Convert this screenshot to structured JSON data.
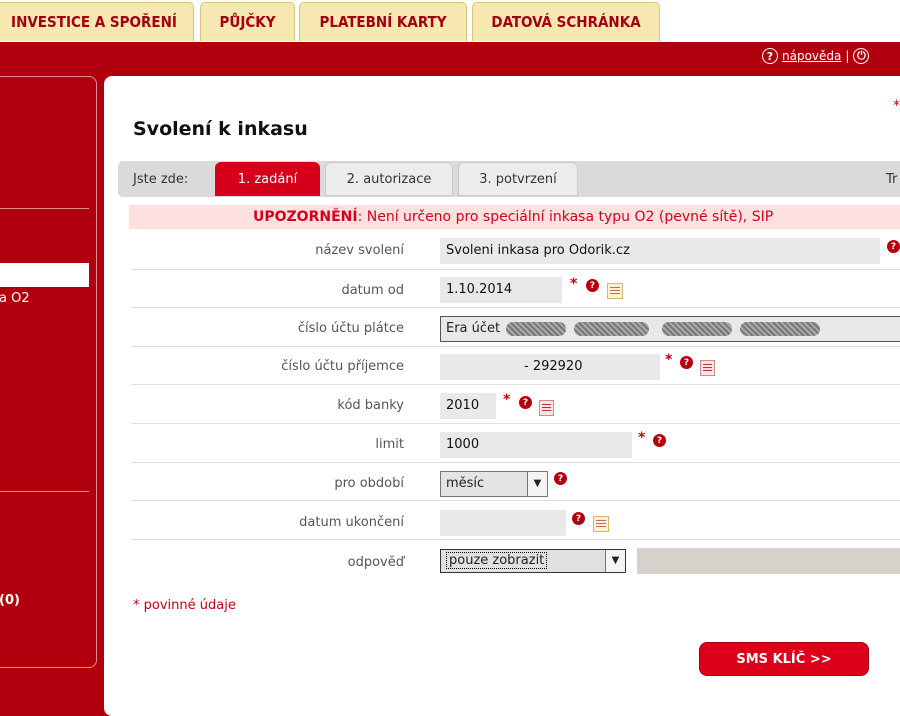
{
  "tabs": [
    "INVESTICE A SPOŘENÍ",
    "PŮJČKY",
    "PLATEBNÍ KARTY",
    "DATOVÁ SCHRÁNKA"
  ],
  "help": {
    "label": "nápověda",
    "separator": "|"
  },
  "sidebar": {
    "item_text": "a O2",
    "count_text": "(0)"
  },
  "page": {
    "title": "Svolení k inkasu",
    "required_mark": "*"
  },
  "breadcrumb": {
    "label": "Jste zde:",
    "steps": [
      "1. zadání",
      "2. autorizace",
      "3. potvrzení"
    ],
    "active_step": 0,
    "right_text": "Tr"
  },
  "warning": {
    "prefix": "UPOZORNĚNÍ",
    "text": ": Není určeno pro speciální inkasa typu O2 (pevné sítě), SIP"
  },
  "form": {
    "fields": [
      {
        "label": "název svolení",
        "value": "Svoleni inkasa pro Odorik.cz"
      },
      {
        "label": "datum od",
        "value": "1.10.2014"
      },
      {
        "label": "číslo účtu plátce",
        "value": "Era účet"
      },
      {
        "label": "číslo účtu příjemce",
        "prefix_value": "",
        "separator": "-",
        "value": "292920"
      },
      {
        "label": "kód banky",
        "value": "2010"
      },
      {
        "label": "limit",
        "value": "1000"
      },
      {
        "label": "pro období",
        "value": "měsíc"
      },
      {
        "label": "datum ukončení",
        "value": ""
      },
      {
        "label": "odpověď",
        "value": "pouze zobrazit"
      }
    ]
  },
  "legend": {
    "star": "*",
    "text": "povinné údaje"
  },
  "actions": {
    "sms_button": "SMS KLÍČ >>"
  }
}
